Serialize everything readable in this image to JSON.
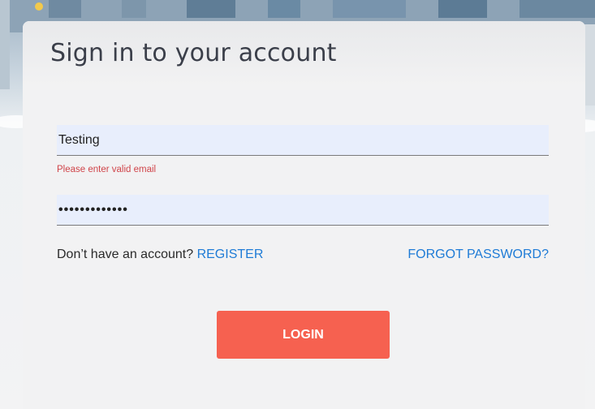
{
  "form": {
    "title": "Sign in to your account",
    "email": {
      "value": "Testing",
      "error": "Please enter valid email"
    },
    "password": {
      "masked_value": "•••••••••••••"
    },
    "no_account_text": "Don’t have an account?",
    "register_label": "REGISTER",
    "forgot_password_label": "FORGOT PASSWORD?",
    "login_label": "LOGIN"
  },
  "colors": {
    "accent_button": "#f66150",
    "link": "#1e7bd6",
    "error": "#d0454a",
    "input_background": "#e8eefc"
  }
}
